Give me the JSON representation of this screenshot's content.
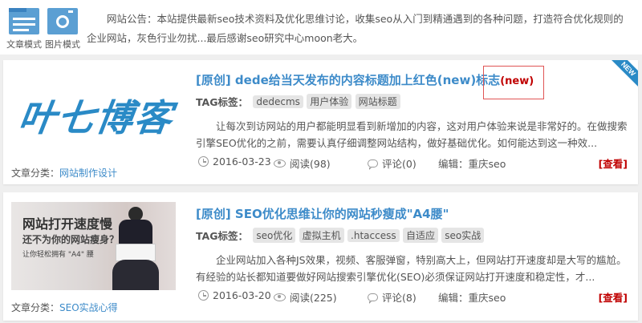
{
  "view_modes": [
    {
      "label": "文章模式",
      "icon": "list-icon"
    },
    {
      "label": "图片模式",
      "icon": "camera-icon"
    }
  ],
  "notice": "网站公告：本站提供最新seo技术资料及优化思维讨论，收集seo从入门到精通遇到的各种问题，打造符合优化规则的企业网站，灰色行业勿扰...最后感谢seo研究中心moon老大。",
  "colors": {
    "accent": "#3d8bc9",
    "highlight": "#c00000",
    "tag_bg": "#e5e5e5"
  },
  "posts": [
    {
      "title": "[原创] dede给当天发布的内容标题加上红色(new)标志",
      "new_badge": "(new)",
      "ribbon": "NEW",
      "thumb_logo": "叶七博客",
      "tag_label": "TAG标签：",
      "tags": [
        "dedecms",
        "用户体验",
        "网站标题"
      ],
      "excerpt": "让每次到访网站的用户都能明显看到新增加的内容，这对用户体验来说是非常好的。在做搜索引擎SEO优化的之前，需要认真仔细调整网站结构，做好基础优化。如何能达到这一种效...",
      "category_label": "文章分类：",
      "category": "网站制作设计",
      "date": "2016-03-23",
      "reads": "阅读(98)",
      "comments": "评论(0)",
      "editor": "编辑：重庆seo",
      "more": "[查看]"
    },
    {
      "title": "[原创] SEO优化思维让你的网站秒瘦成\"A4腰\"",
      "thumb_heading": "网站打开速度慢",
      "thumb_sub1": "还不为你的网站瘦身？",
      "thumb_sub2": "让你轻松拥有 \"A4\" 腰",
      "tag_label": "TAG标签：",
      "tags": [
        "seo优化",
        "虚拟主机",
        ".htaccess",
        "自适应",
        "seo实战"
      ],
      "excerpt": "企业网站加入各种JS效果，视频、客服弹窗，特别高大上，但网站打开速度却是大写的尴尬。有经验的站长都知道要做好网站搜索引擎优化(SEO)必须保证网站打开速度和稳定性，才...",
      "category_label": "文章分类：",
      "category": "SEO实战心得",
      "date": "2016-03-20",
      "reads": "阅读(225)",
      "comments": "评论(8)",
      "editor": "编辑：重庆seo",
      "more": "[查看]"
    }
  ]
}
